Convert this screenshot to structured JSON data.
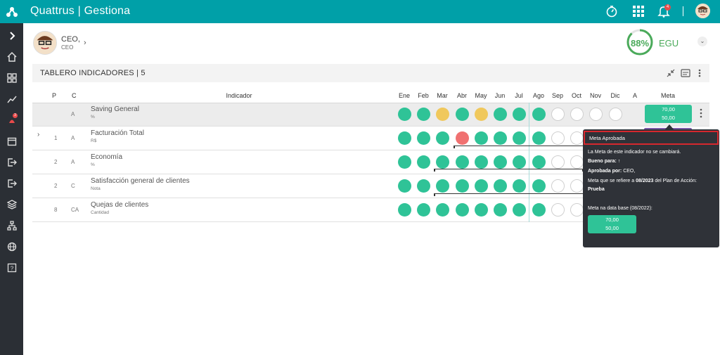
{
  "app": {
    "title": "Quattrus | Gestiona"
  },
  "topbar": {
    "bell_count": "4"
  },
  "sidebar": {
    "badge_count": "3",
    "items": [
      "expand",
      "home",
      "dashboard",
      "chart",
      "risk",
      "calendar",
      "logout",
      "exit",
      "layers",
      "org",
      "globe",
      "help"
    ]
  },
  "user": {
    "name": "CEO,",
    "role": "CEO"
  },
  "egu": {
    "percent": "88%",
    "label": "EGU",
    "value": 0.88,
    "color": "#4aaa5a"
  },
  "panel": {
    "title": "TABLERO INDICADORES | 5"
  },
  "columns": {
    "p": "P",
    "c": "C",
    "indicador": "Indicador",
    "months": [
      "Ene",
      "Feb",
      "Mar",
      "Abr",
      "May",
      "Jun",
      "Jul",
      "Ago",
      "Sep",
      "Oct",
      "Nov",
      "Dic"
    ],
    "a": "A",
    "meta": "Meta"
  },
  "rows": [
    {
      "p": "",
      "c": "A",
      "name": "Saving General",
      "unit": "%",
      "status": [
        "g",
        "g",
        "y",
        "g",
        "y",
        "g",
        "g",
        "g",
        "e",
        "e",
        "e",
        "e"
      ],
      "meta_top": "70,00",
      "meta_bottom": "50,00"
    },
    {
      "p": "1",
      "c": "A",
      "name": "Facturación Total",
      "unit": "R$",
      "status": [
        "g",
        "g",
        "g",
        "r",
        "g",
        "g",
        "g",
        "g",
        "e",
        "e",
        "e",
        "e"
      ]
    },
    {
      "p": "2",
      "c": "A",
      "name": "Economía",
      "unit": "%",
      "status": [
        "g",
        "g",
        "g",
        "g",
        "g",
        "g",
        "g",
        "g",
        "e",
        "e",
        "e",
        "e"
      ]
    },
    {
      "p": "2",
      "c": "C",
      "name": "Satisfacción general de clientes",
      "unit": "Nota",
      "status": [
        "g",
        "g",
        "g",
        "g",
        "g",
        "g",
        "g",
        "g",
        "e",
        "e",
        "e",
        "e"
      ]
    },
    {
      "p": "8",
      "c": "CA",
      "name": "Quejas de clientes",
      "unit": "Cantidad",
      "status": [
        "g",
        "g",
        "g",
        "g",
        "g",
        "g",
        "g",
        "g",
        "e",
        "e",
        "e",
        "e"
      ]
    }
  ],
  "tooltip": {
    "title": "Meta Aprobada",
    "line1": "La Meta de este indicador no se cambiará.",
    "bueno_label": "Bueno para:",
    "bueno_value": "↑",
    "aprobada_label": "Aprobada por:",
    "aprobada_value": "CEO,",
    "refiere_prefix": "Meta que se refiere a",
    "refiere_date": "08/2023",
    "refiere_suffix": "del Plan de Acción:",
    "plan": "Prueba",
    "base_label": "Meta na data base (08/2022):",
    "meta_top": "70,00",
    "meta_bottom": "50,00"
  },
  "colors": {
    "teal": "#00a0a8",
    "green": "#2fc397",
    "yellow": "#f0c85c",
    "red": "#f07171",
    "sidebar": "#2b2f35"
  }
}
